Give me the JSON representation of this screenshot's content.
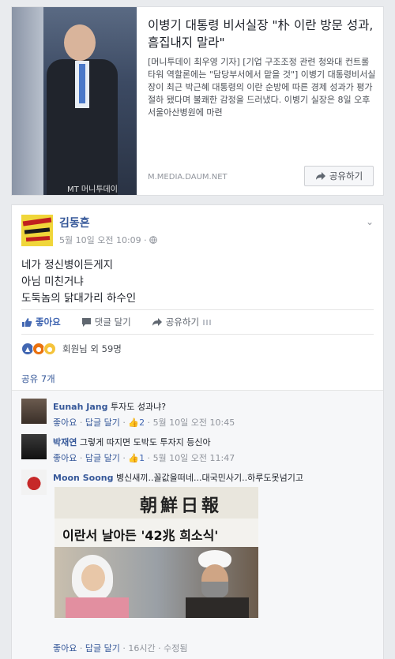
{
  "link_preview": {
    "title": "이병기 대통령 비서실장 \"朴 이란 방문 성과, 흠집내지 말라\"",
    "description": "[머니투데이 최우영 기자] [기업 구조조정 관련 청와대 컨트롤타워 역할론에는 \"담당부서에서 맡을 것\"] 이병기 대통령비서실장이 최근 박근혜 대통령의 이란 순방에 따른 경제 성과가 평가절하 됐다며 불쾌한 감정을 드러냈다. 이병기 실장은 8일 오후 서울아산병원에 마련",
    "domain": "M.MEDIA.DAUM.NET",
    "share_label": "공유하기",
    "image_watermark": "MT 머니투데이"
  },
  "post": {
    "author": "김동흔",
    "timestamp": "5월 10일 오전 10:09 · ",
    "privacy_icon": "globe-icon",
    "lines": [
      "네가 정신병이든게지",
      "아님 미친거냐",
      "도둑놈의 닭대가리 하수인"
    ],
    "actions": {
      "like": "좋아요",
      "comment": "댓글 달기",
      "share": "공유하기"
    },
    "reactions_text": "회원님 외 59명",
    "shares_text": "공유 7개"
  },
  "comments": [
    {
      "name": "Eunah Jang",
      "text": "투자도 성과냐?",
      "like": "좋아요",
      "reply": "답글 달기",
      "likes": "2",
      "time": "5월 10일 오전 10:45"
    },
    {
      "name": "박재연",
      "text": "그렇게 따지면 도박도 투자지 등신아",
      "like": "좋아요",
      "reply": "답글 달기",
      "likes": "1",
      "time": "5월 10일 오전 11:47"
    },
    {
      "name": "Moon Soong",
      "text": "병신새끼..꼴값을떠네...대국민사기..하루도못넘기고",
      "like": "좋아요",
      "reply": "답글 달기",
      "time": "16시간",
      "edited": "수정됨"
    }
  ],
  "news_clipping": {
    "masthead": "朝鮮日報",
    "headline": "이란서 날아든 '42兆 희소식'"
  },
  "colors": {
    "link": "#365899",
    "accent": "#4267b2",
    "muted": "#90949c",
    "background": "#e9ebee"
  }
}
